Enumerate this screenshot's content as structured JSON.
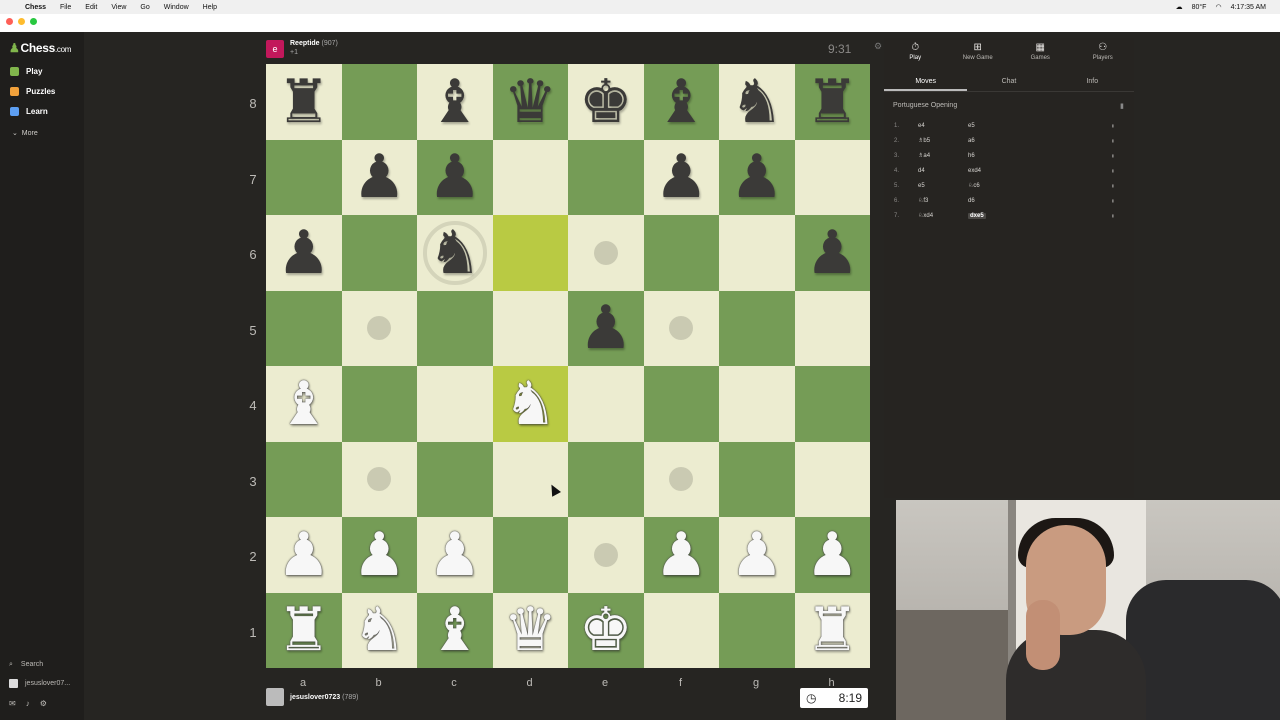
{
  "menubar": {
    "app": "Chess",
    "items": [
      "File",
      "Edit",
      "View",
      "Go",
      "Window",
      "Help"
    ],
    "weather": "80°F",
    "time": "4:17:35 AM"
  },
  "sidebar": {
    "logo_main": "Chess",
    "logo_suffix": ".com",
    "items": [
      {
        "label": "Play",
        "color": "#81b64c"
      },
      {
        "label": "Puzzles",
        "color": "#f1a13b"
      },
      {
        "label": "Learn",
        "color": "#5d9ff2"
      }
    ],
    "more": "More",
    "search": "Search",
    "username": "jesuslover07..."
  },
  "opponent": {
    "initial": "e",
    "name": "Reeptide",
    "rating": "(907)",
    "sub": "+1",
    "clock": "9:31"
  },
  "me": {
    "name": "jesuslover0723",
    "rating": "(789)",
    "clock": "8:19"
  },
  "board": {
    "files": [
      "a",
      "b",
      "c",
      "d",
      "e",
      "f",
      "g",
      "h"
    ],
    "ranks": [
      "8",
      "7",
      "6",
      "5",
      "4",
      "3",
      "2",
      "1"
    ],
    "position": [
      [
        "bR",
        "",
        "bB",
        "bQ",
        "bK",
        "bB",
        "bN",
        "bR"
      ],
      [
        "",
        "bP",
        "bP",
        "",
        "",
        "bP",
        "bP",
        ""
      ],
      [
        "bP",
        "",
        "bN",
        "",
        "",
        "",
        "",
        "bP"
      ],
      [
        "",
        "",
        "",
        "",
        "bP",
        "",
        "",
        ""
      ],
      [
        "wB",
        "",
        "",
        "wN",
        "",
        "",
        "",
        ""
      ],
      [
        "",
        "",
        "",
        "",
        "",
        "",
        "",
        ""
      ],
      [
        "wP",
        "wP",
        "wP",
        "",
        "",
        "wP",
        "wP",
        "wP"
      ],
      [
        "wR",
        "wN",
        "wB",
        "wQ",
        "wK",
        "",
        "",
        "wR"
      ]
    ],
    "highlights": [
      "d6",
      "d4"
    ],
    "selected": "c6",
    "hints": [
      "e6",
      "b5",
      "f5",
      "b3",
      "f3",
      "e2"
    ],
    "light_color": "#ececd0",
    "dark_color": "#759c56"
  },
  "panel": {
    "tabs": [
      {
        "label": "Play",
        "icon": "stopwatch-icon"
      },
      {
        "label": "New Game",
        "icon": "plus-square-icon"
      },
      {
        "label": "Games",
        "icon": "board-icon"
      },
      {
        "label": "Players",
        "icon": "people-icon"
      }
    ],
    "subtabs": [
      "Moves",
      "Chat",
      "Info"
    ],
    "opening": "Portuguese Opening",
    "moves": [
      {
        "n": "1.",
        "w": "e4",
        "b": "e5"
      },
      {
        "n": "2.",
        "w": "♗b5",
        "b": "a6"
      },
      {
        "n": "3.",
        "w": "♗a4",
        "b": "h6"
      },
      {
        "n": "4.",
        "w": "d4",
        "b": "exd4"
      },
      {
        "n": "5.",
        "w": "e5",
        "b": "♘c6"
      },
      {
        "n": "6.",
        "w": "♘f3",
        "b": "d6"
      },
      {
        "n": "7.",
        "w": "♘xd4",
        "b": "dxe5"
      }
    ]
  }
}
